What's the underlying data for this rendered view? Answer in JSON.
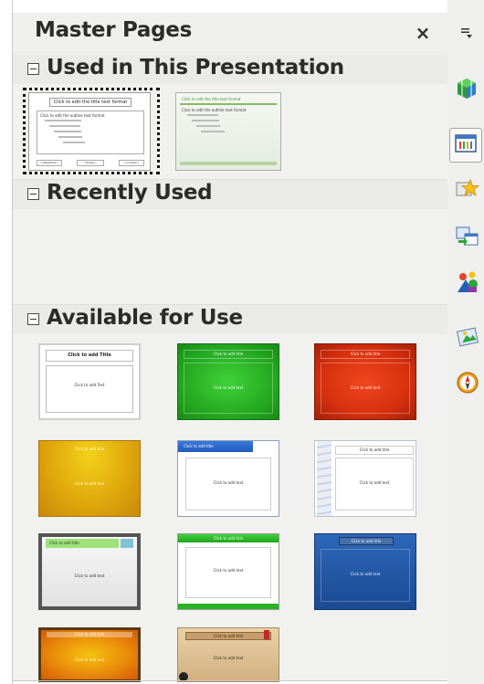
{
  "panel": {
    "title": "Master Pages",
    "close_glyph": "×"
  },
  "sections": {
    "used": {
      "title": "Used in This Presentation"
    },
    "recent": {
      "title": "Recently Used"
    },
    "available": {
      "title": "Available for Use"
    }
  },
  "used_thumbs": [
    {
      "title": "Click to edit the title text format",
      "body": "Click to edit the outline text format",
      "footer": [
        "<date/time>",
        "<footer>",
        "<number>"
      ]
    },
    {
      "title": "Click to edit the title text format",
      "body": "Click to edit the outline text format"
    }
  ],
  "available_thumbs": [
    {
      "title": "Click to add Title",
      "body": "Click to add Text"
    },
    {
      "title": "Click to add title",
      "body": "Click to add text"
    },
    {
      "title": "Click to add title",
      "body": "Click to add text"
    },
    {
      "title": "Click to add title",
      "body": "Click to add text"
    },
    {
      "title": "Click to add title",
      "body": "Click to add text"
    },
    {
      "title": "Click to add title",
      "body": "Click to add text"
    },
    {
      "title": "Click to add title",
      "body": "Click to add text"
    },
    {
      "title": "Click to add title",
      "body": "Click to add text"
    },
    {
      "title": "Click to add title",
      "body": "Click to add text"
    },
    {
      "title": "Click to add title",
      "body": "Click to add text"
    },
    {
      "title": "Click to add title",
      "body": "Click to add text"
    }
  ],
  "sidebar": {
    "icons": [
      "sidebar-menu-icon",
      "properties-icon",
      "master-slides-icon",
      "animation-icon",
      "slide-transition-icon",
      "gallery-icon",
      "styles-icon",
      "navigator-icon"
    ]
  }
}
